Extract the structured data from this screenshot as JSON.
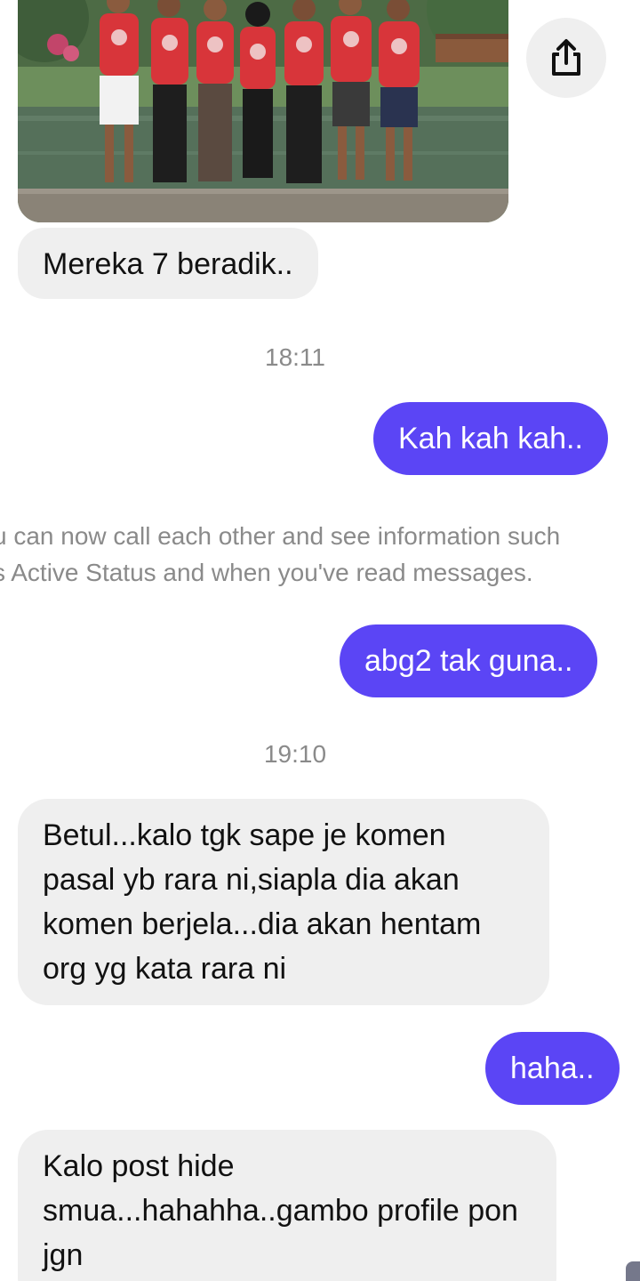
{
  "messages": {
    "photo_icon": "group-photo-image",
    "share_icon": "share-icon",
    "msg1": "Mereka 7 beradik..",
    "time1": "18:11",
    "msg2": "Kah kah kah..",
    "system_line1": "u can now call each other and see information such",
    "system_line2": "s Active Status and when you've read messages.",
    "msg3": "abg2 tak guna..",
    "time2": "19:10",
    "msg4": "Betul...kalo tgk sape je komen pasal yb rara ni,siapla dia akan komen berjela...dia akan hentam org yg kata rara ni",
    "msg5": "haha..",
    "msg6": "Kalo post hide smua...hahahha..gambo profile pon jgn"
  },
  "colors": {
    "outgoing_bubble": "#5b45f5",
    "incoming_bubble": "#efefef",
    "meta_text": "#8a8a8a"
  }
}
